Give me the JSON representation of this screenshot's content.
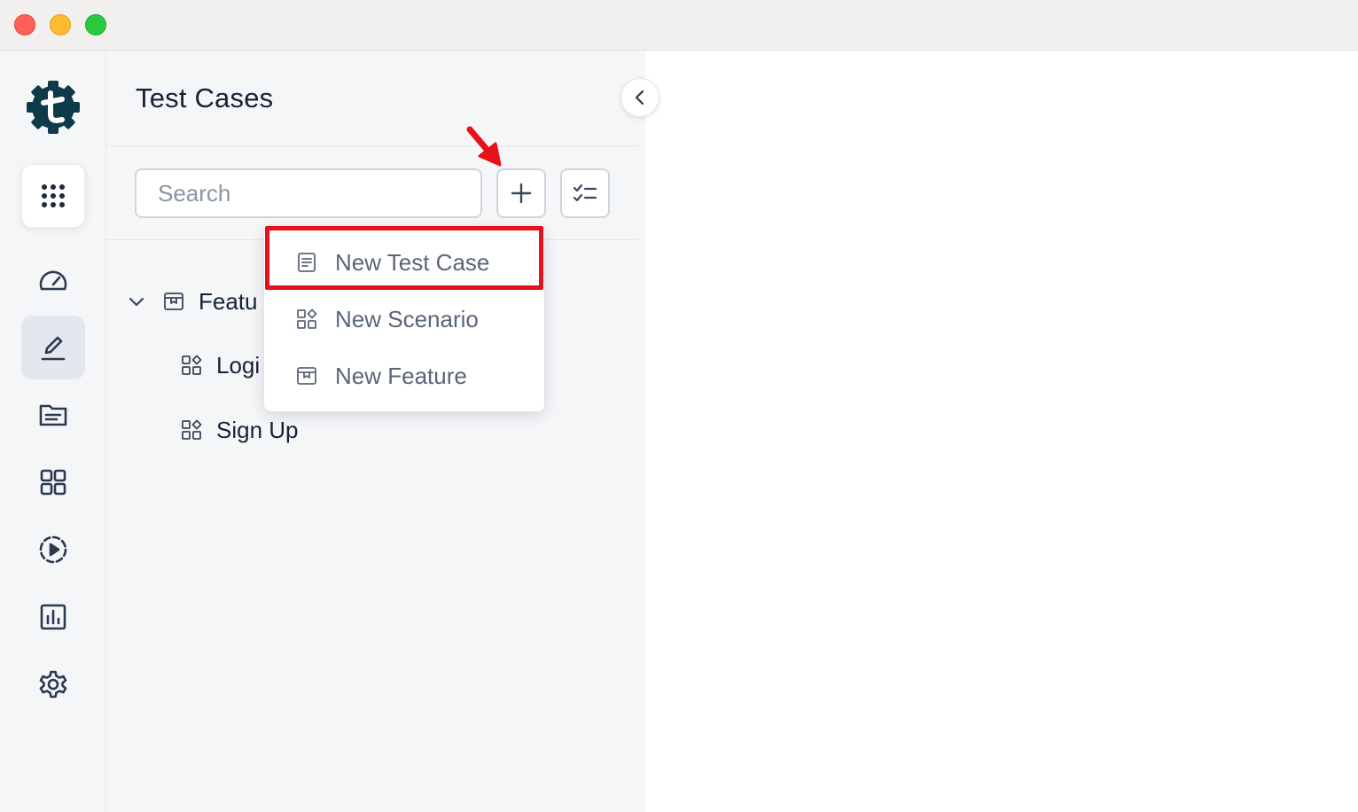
{
  "window": {
    "controls": [
      "close",
      "minimize",
      "zoom"
    ]
  },
  "rail": {
    "logo_icon": "gear-t-logo-icon",
    "items": [
      {
        "icon": "apps-grid-icon"
      },
      {
        "icon": "dashboard-gauge-icon"
      },
      {
        "icon": "pen-edit-icon",
        "active": true
      },
      {
        "icon": "folder-icon"
      },
      {
        "icon": "grid-icon"
      },
      {
        "icon": "play-circle-icon"
      },
      {
        "icon": "bar-chart-icon"
      },
      {
        "icon": "settings-gear-icon"
      }
    ]
  },
  "panel": {
    "title": "Test Cases",
    "search": {
      "placeholder": "Search",
      "value": ""
    },
    "tree": {
      "feature": {
        "label": "Featu",
        "icon": "feature-box-icon",
        "expanded": true
      },
      "children": [
        {
          "label": "Logi",
          "icon": "scenario-icon"
        },
        {
          "label": "Sign Up",
          "icon": "scenario-icon"
        }
      ]
    }
  },
  "menu": {
    "items": [
      {
        "label": "New Test Case",
        "icon": "document-lines-icon",
        "highlighted": true
      },
      {
        "label": "New Scenario",
        "icon": "scenario-icon"
      },
      {
        "label": "New Feature",
        "icon": "feature-box-icon"
      }
    ]
  },
  "colors": {
    "accent_dark": "#0f3a4a",
    "annotation_red": "#e8101a",
    "text_primary": "#142238",
    "text_muted": "#5a6678"
  }
}
